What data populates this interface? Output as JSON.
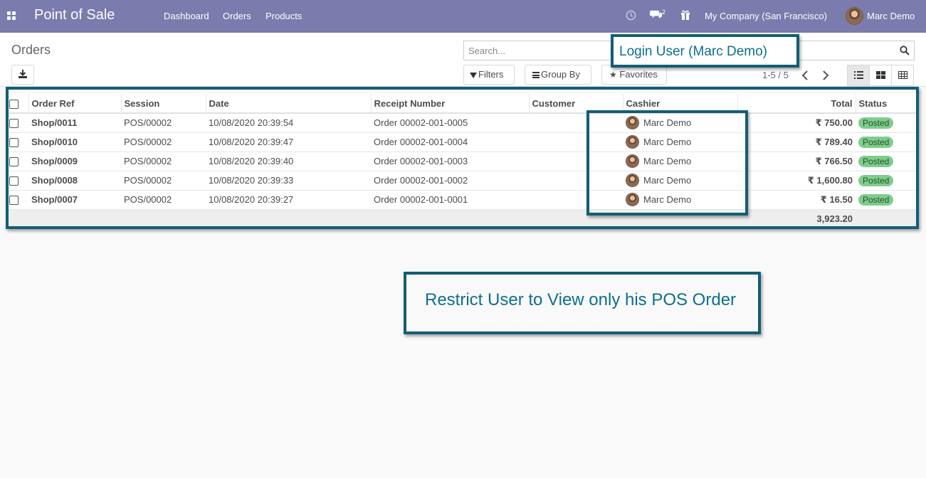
{
  "navbar": {
    "app_title": "Point of Sale",
    "menu": [
      "Dashboard",
      "Orders",
      "Products"
    ],
    "messages_count": "2",
    "company": "My Company (San Francisco)",
    "user": "Marc Demo"
  },
  "control_panel": {
    "breadcrumb": "Orders",
    "search_placeholder": "Search...",
    "filters_label": "Filters",
    "group_by_label": "Group By",
    "favorites_label": "Favorites",
    "pager": "1-5 / 5"
  },
  "table": {
    "columns": [
      "Order Ref",
      "Session",
      "Date",
      "Receipt Number",
      "Customer",
      "Cashier",
      "Total",
      "Status"
    ],
    "rows": [
      {
        "ref": "Shop/0011",
        "session": "POS/00002",
        "date": "10/08/2020 20:39:54",
        "receipt": "Order 00002-001-0005",
        "customer": "",
        "cashier": "Marc Demo",
        "total": "₹ 750.00",
        "status": "Posted"
      },
      {
        "ref": "Shop/0010",
        "session": "POS/00002",
        "date": "10/08/2020 20:39:47",
        "receipt": "Order 00002-001-0004",
        "customer": "",
        "cashier": "Marc Demo",
        "total": "₹ 789.40",
        "status": "Posted"
      },
      {
        "ref": "Shop/0009",
        "session": "POS/00002",
        "date": "10/08/2020 20:39:40",
        "receipt": "Order 00002-001-0003",
        "customer": "",
        "cashier": "Marc Demo",
        "total": "₹ 766.50",
        "status": "Posted"
      },
      {
        "ref": "Shop/0008",
        "session": "POS/00002",
        "date": "10/08/2020 20:39:33",
        "receipt": "Order 00002-001-0002",
        "customer": "",
        "cashier": "Marc Demo",
        "total": "₹ 1,600.80",
        "status": "Posted"
      },
      {
        "ref": "Shop/0007",
        "session": "POS/00002",
        "date": "10/08/2020 20:39:27",
        "receipt": "Order 00002-001-0001",
        "customer": "",
        "cashier": "Marc Demo",
        "total": "₹ 16.50",
        "status": "Posted"
      }
    ],
    "grand_total": "3,923.20"
  },
  "annotations": {
    "login_user": "Login User (Marc Demo)",
    "restrict": "Restrict User to View only his POS Order"
  },
  "colors": {
    "navbar": "#7c7bad",
    "annotation": "#135e75",
    "status_badge": "#7dce8b"
  }
}
